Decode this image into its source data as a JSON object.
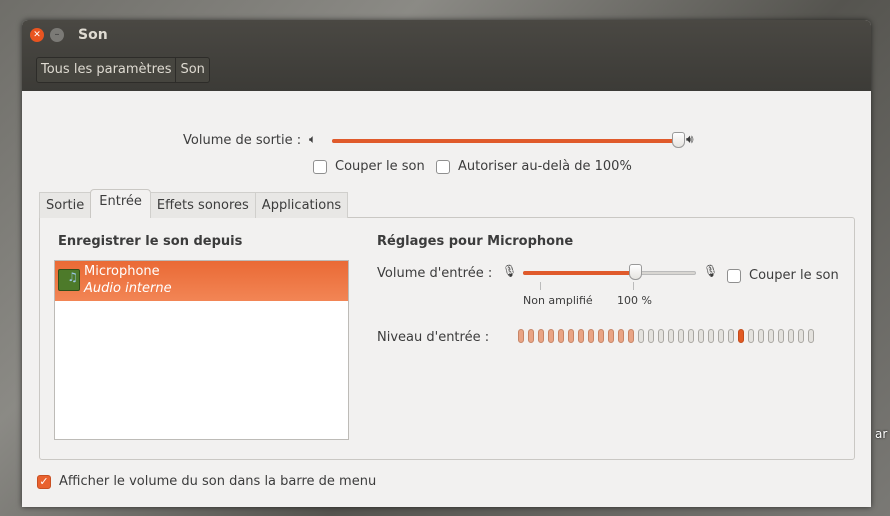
{
  "desktop": {
    "label_fragment": "ar"
  },
  "window": {
    "title": "Son",
    "breadcrumbs": [
      "Tous les paramètres",
      "Son"
    ]
  },
  "output": {
    "label": "Volume de sortie :",
    "volume_percent": 100,
    "mute_label": "Couper le son",
    "overamp_label": "Autoriser au-delà de 100%"
  },
  "tabs": [
    "Sortie",
    "Entrée",
    "Effets sonores",
    "Applications"
  ],
  "active_tab": "Entrée",
  "input": {
    "record_from_label": "Enregistrer le son depuis",
    "devices": [
      {
        "name": "Microphone",
        "description": "Audio interne",
        "selected": true
      }
    ],
    "settings_title": "Réglages pour Microphone",
    "volume_label": "Volume d'entrée :",
    "volume_percent": 65,
    "mark_unamplified": "Non amplifié",
    "mark_100": "100 %",
    "mute_label": "Couper le son",
    "level_label": "Niveau d'entrée :",
    "level_bars_total": 30,
    "level_bars_lit": 12,
    "level_peak_index": 22
  },
  "footer": {
    "show_volume_label": "Afficher le volume du son dans la barre de menu",
    "show_volume_checked": true
  },
  "colors": {
    "accent": "#e95420",
    "titlebar": "#3c3b37"
  }
}
